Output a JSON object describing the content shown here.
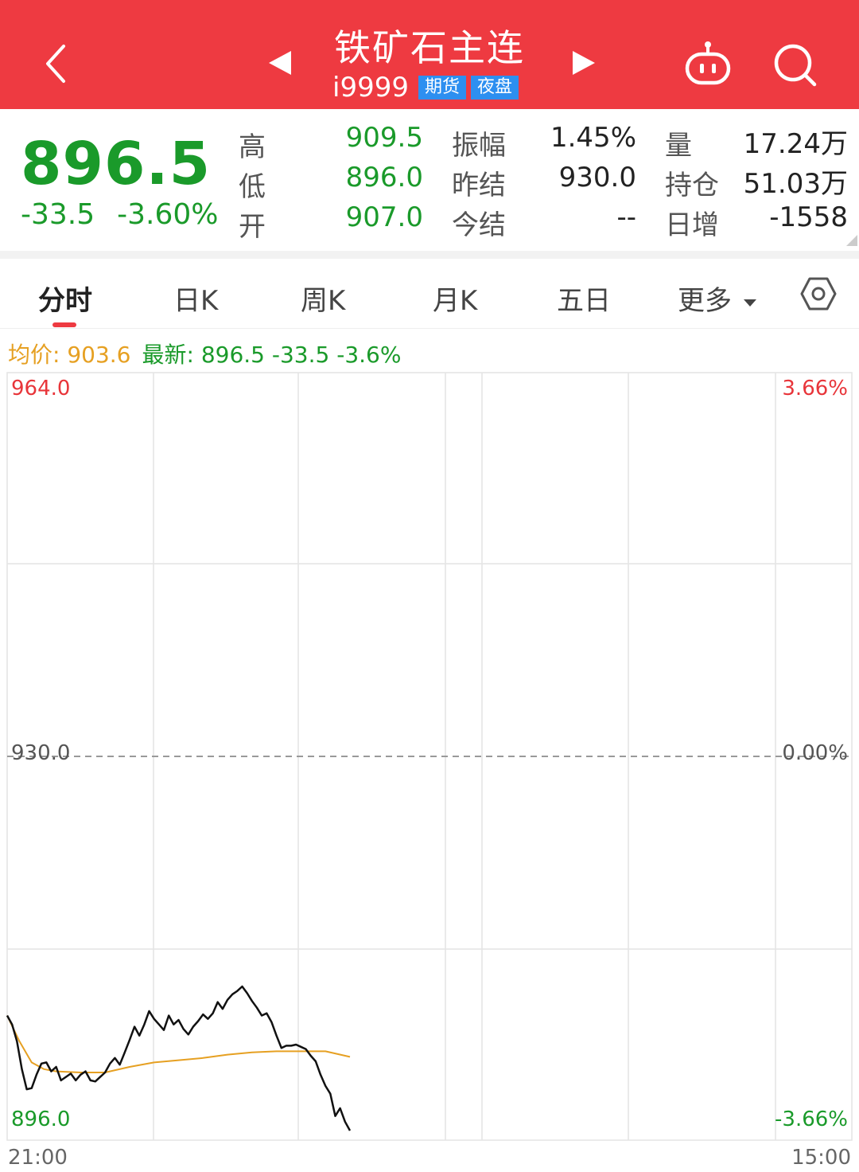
{
  "header": {
    "title": "铁矿石主连",
    "code": "i9999",
    "tags": [
      "期货",
      "夜盘"
    ],
    "bg_color": "#ee3a41"
  },
  "icons": [
    "back-arrow-icon",
    "prev-triangle-icon",
    "next-triangle-icon",
    "robot-icon",
    "search-icon",
    "settings-hexagon-icon",
    "dropdown-triangle-icon"
  ],
  "quote": {
    "price": "896.5",
    "change": "-33.5",
    "change_pct": "-3.60%",
    "high_label": "高",
    "high": "909.5",
    "low_label": "低",
    "low": "896.0",
    "open_label": "开",
    "open": "907.0",
    "amplitude_label": "振幅",
    "amplitude": "1.45%",
    "prev_settle_label": "昨结",
    "prev_settle": "930.0",
    "settle_label": "今结",
    "settle": "--",
    "volume_label": "量",
    "volume": "17.24万",
    "open_interest_label": "持仓",
    "open_interest": "51.03万",
    "daily_inc_label": "日增",
    "daily_inc": "-1558"
  },
  "tabs": [
    {
      "label": "分时",
      "active": true
    },
    {
      "label": "日K"
    },
    {
      "label": "周K"
    },
    {
      "label": "月K"
    },
    {
      "label": "五日"
    },
    {
      "label": "更多"
    }
  ],
  "info": {
    "avg": "均价: 903.6",
    "latest": "最新: 896.5  -33.5  -3.6%"
  },
  "colors": {
    "up": "#e8353a",
    "down": "#1a9a2a",
    "avg_line": "#e6a022",
    "price_line": "#111111"
  },
  "chart_data": {
    "type": "line",
    "y_top_label": "964.0",
    "y_mid_label": "930.0",
    "y_bottom_label": "896.0",
    "pct_top_label": "3.66%",
    "pct_mid_label": "0.00%",
    "pct_bottom_label": "-3.66%",
    "x_start_label": "21:00",
    "x_end_label": "15:00",
    "ylim": [
      896.0,
      964.0
    ],
    "prev_settle": 930.0,
    "total_minutes": 345,
    "series": [
      {
        "name": "最新",
        "color": "#111111",
        "x": [
          0,
          2,
          4,
          6,
          8,
          10,
          12,
          14,
          16,
          18,
          20,
          22,
          24,
          26,
          28,
          30,
          32,
          34,
          36,
          38,
          40,
          42,
          44,
          46,
          48,
          50,
          52,
          54,
          56,
          58,
          60,
          62,
          64,
          66,
          68,
          70,
          72,
          74,
          76,
          78,
          80,
          82,
          84,
          86,
          88,
          90,
          92,
          94,
          96,
          98,
          100,
          102,
          104,
          106,
          108,
          110,
          112,
          114,
          116,
          118,
          120,
          122,
          124,
          126,
          128,
          130,
          132,
          134,
          136,
          138,
          140
        ],
        "values": [
          906.8,
          906.0,
          904.5,
          902.0,
          900.2,
          900.3,
          901.5,
          902.5,
          902.6,
          901.8,
          902.2,
          901.0,
          901.3,
          901.6,
          901.0,
          901.5,
          901.8,
          901.0,
          900.9,
          901.3,
          901.7,
          902.5,
          903.0,
          902.4,
          903.5,
          904.6,
          905.8,
          905.0,
          906.0,
          907.2,
          906.5,
          906.0,
          905.5,
          906.8,
          906.0,
          906.4,
          905.6,
          905.1,
          905.8,
          906.3,
          906.9,
          906.5,
          907.0,
          908.0,
          907.4,
          908.2,
          908.7,
          909.0,
          909.4,
          908.8,
          908.1,
          907.5,
          906.8,
          907.0,
          906.2,
          905.0,
          903.9,
          904.1,
          904.1,
          904.2,
          904.0,
          903.8,
          903.2,
          902.7,
          901.5,
          900.5,
          899.8,
          897.8,
          898.5,
          897.3,
          896.5
        ]
      },
      {
        "name": "均价",
        "color": "#e6a022",
        "x": [
          0,
          5,
          10,
          15,
          20,
          30,
          40,
          50,
          60,
          70,
          80,
          90,
          100,
          110,
          120,
          130,
          140
        ],
        "values": [
          906.8,
          904.5,
          902.6,
          902.0,
          901.8,
          901.7,
          901.7,
          902.2,
          902.6,
          902.8,
          903.0,
          903.3,
          903.5,
          903.6,
          903.6,
          903.6,
          903.1
        ]
      }
    ]
  }
}
